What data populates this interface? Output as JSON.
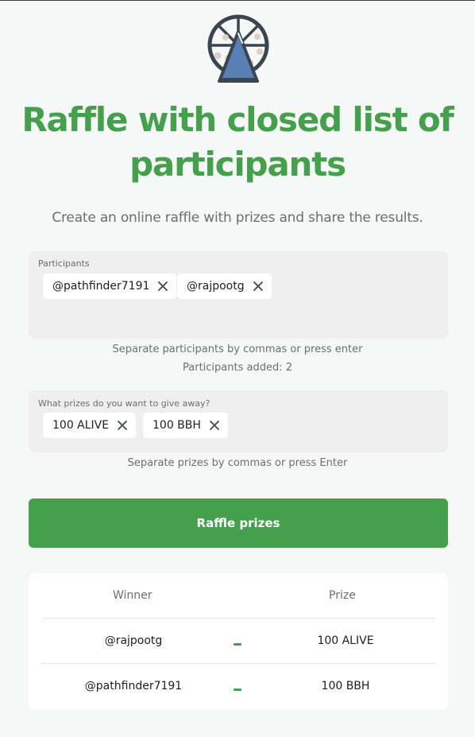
{
  "title": "Raffle with closed list of participants",
  "subtitle": "Create an online raffle with prizes and share the results.",
  "participants": {
    "label": "Participants",
    "chips": [
      "@pathfinder7191",
      "@rajpootg"
    ],
    "hint": "Separate participants by commas or press enter",
    "count_text": "Participants added: 2"
  },
  "prizes": {
    "label": "What prizes do you want to give away?",
    "chips": [
      "100 ALIVE",
      "100 BBH"
    ],
    "hint": "Separate prizes by commas or press Enter"
  },
  "button": {
    "label": "Raffle prizes"
  },
  "results": {
    "headers": {
      "winner": "Winner",
      "prize": "Prize"
    },
    "rows": [
      {
        "winner": "@rajpootg",
        "prize": "100 ALIVE"
      },
      {
        "winner": "@pathfinder7191",
        "prize": "100 BBH"
      }
    ]
  },
  "colors": {
    "accent": "#44a04c",
    "logo_dark": "#3a4550",
    "logo_blue": "#5a7fb5"
  },
  "icons": {
    "logo": "ferris-wheel-icon",
    "remove": "close-icon"
  }
}
